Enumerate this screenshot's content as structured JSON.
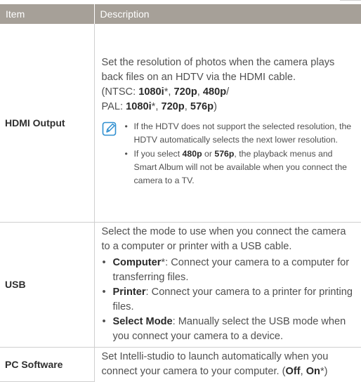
{
  "table": {
    "headers": {
      "item": "Item",
      "description": "Description"
    },
    "hdmi": {
      "item": "HDMI Output",
      "p1": "Set the resolution of photos when the camera plays back files on an HDTV via the HDMI cable.",
      "ntsc_prefix": "(NTSC: ",
      "ntsc_1080i": "1080i",
      "star": "*",
      "sep": ", ",
      "ntsc_720p": "720p",
      "ntsc_480p": "480p",
      "slash": "/",
      "pal_prefix": "PAL: ",
      "pal_1080i": "1080i",
      "pal_720p": "720p",
      "pal_576p": "576p",
      "close": ")",
      "note_icon": "note-pencil-icon",
      "note1": "If the HDTV does not support the selected resolution, the HDTV automatically selects the next lower resolution.",
      "note2_a": "If you select ",
      "note2_480p": "480p",
      "note2_or": " or ",
      "note2_576p": "576p",
      "note2_b": ", the playback menus and Smart Album will not be available when you connect the camera to a TV."
    },
    "usb": {
      "item": "USB",
      "intro": "Select the mode to use when you connect the camera to a computer or printer with a USB cable.",
      "options": [
        {
          "label": "Computer",
          "mark": "*",
          "text": ": Connect your camera to a computer for transferring files."
        },
        {
          "label": "Printer",
          "mark": "",
          "text": ": Connect your camera to a printer for printing files."
        },
        {
          "label": "Select Mode",
          "mark": "",
          "text": ": Manually select the USB mode when you connect your camera to a device."
        }
      ]
    },
    "pc": {
      "item": "PC Software",
      "text": "Set Intelli-studio to launch automatically when you connect your camera to your computer. (",
      "off": "Off",
      "sep": ", ",
      "on": "On",
      "tail": "*)"
    }
  }
}
